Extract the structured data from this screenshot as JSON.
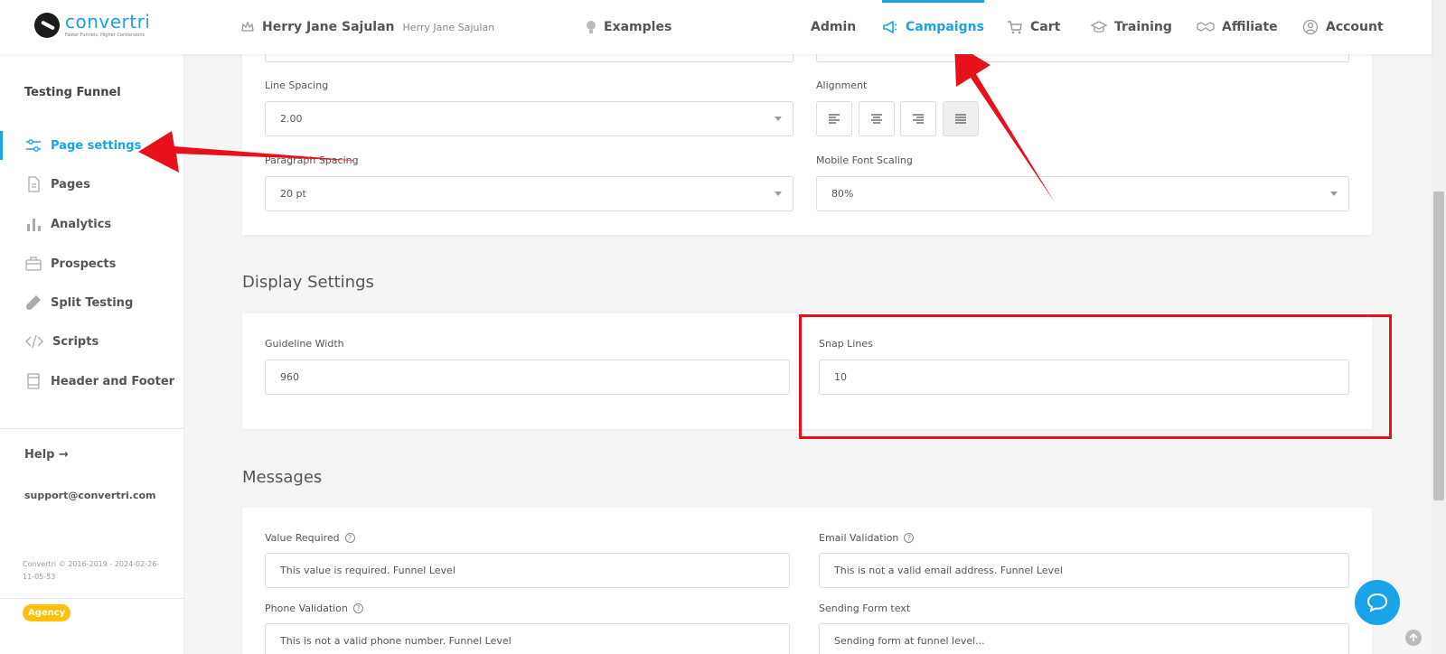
{
  "brand": {
    "name": "convertri",
    "tagline": "Faster Funnels, Higher Conversions"
  },
  "nav": {
    "user_name": "Herry Jane Sajulan",
    "user_sub": "Herry Jane Sajulan",
    "examples": "Examples",
    "admin": "Admin",
    "campaigns": "Campaigns",
    "cart": "Cart",
    "training": "Training",
    "affiliate": "Affiliate",
    "account": "Account"
  },
  "sidebar": {
    "funnel_title": "Testing Funnel",
    "items": [
      {
        "label": "Page settings",
        "icon": "sliders-icon"
      },
      {
        "label": "Pages",
        "icon": "file-icon"
      },
      {
        "label": "Analytics",
        "icon": "bar-chart-icon"
      },
      {
        "label": "Prospects",
        "icon": "briefcase-icon"
      },
      {
        "label": "Split Testing",
        "icon": "test-tube-icon"
      },
      {
        "label": "Scripts",
        "icon": "code-icon"
      },
      {
        "label": "Header and Footer",
        "icon": "layout-icon"
      }
    ],
    "help": "Help →",
    "support": "support@convertri.com",
    "copyright": "Convertri © 2016-2019 - 2024-02-26-11-05-53",
    "agency": "Agency"
  },
  "typography": {
    "line_spacing_label": "Line Spacing",
    "line_spacing_value": "2.00",
    "alignment_label": "Alignment",
    "paragraph_spacing_label": "Paragraph Spacing",
    "paragraph_spacing_value": "20 pt",
    "mobile_font_scaling_label": "Mobile Font Scaling",
    "mobile_font_scaling_value": "80%"
  },
  "display": {
    "title": "Display Settings",
    "guideline_width_label": "Guideline Width",
    "guideline_width_value": "960",
    "snap_lines_label": "Snap Lines",
    "snap_lines_value": "10"
  },
  "messages": {
    "title": "Messages",
    "value_required_label": "Value Required",
    "value_required_value": "This value is required. Funnel Level",
    "email_validation_label": "Email Validation",
    "email_validation_value": "This is not a valid email address. Funnel Level",
    "phone_validation_label": "Phone Validation",
    "phone_validation_value": "This is not a valid phone number. Funnel Level",
    "sending_form_label": "Sending Form text",
    "sending_form_value": "Sending form at funnel level..."
  },
  "colors": {
    "accent": "#1aa3e8",
    "annotation": "#e8101a",
    "badge": "#ffc107"
  }
}
